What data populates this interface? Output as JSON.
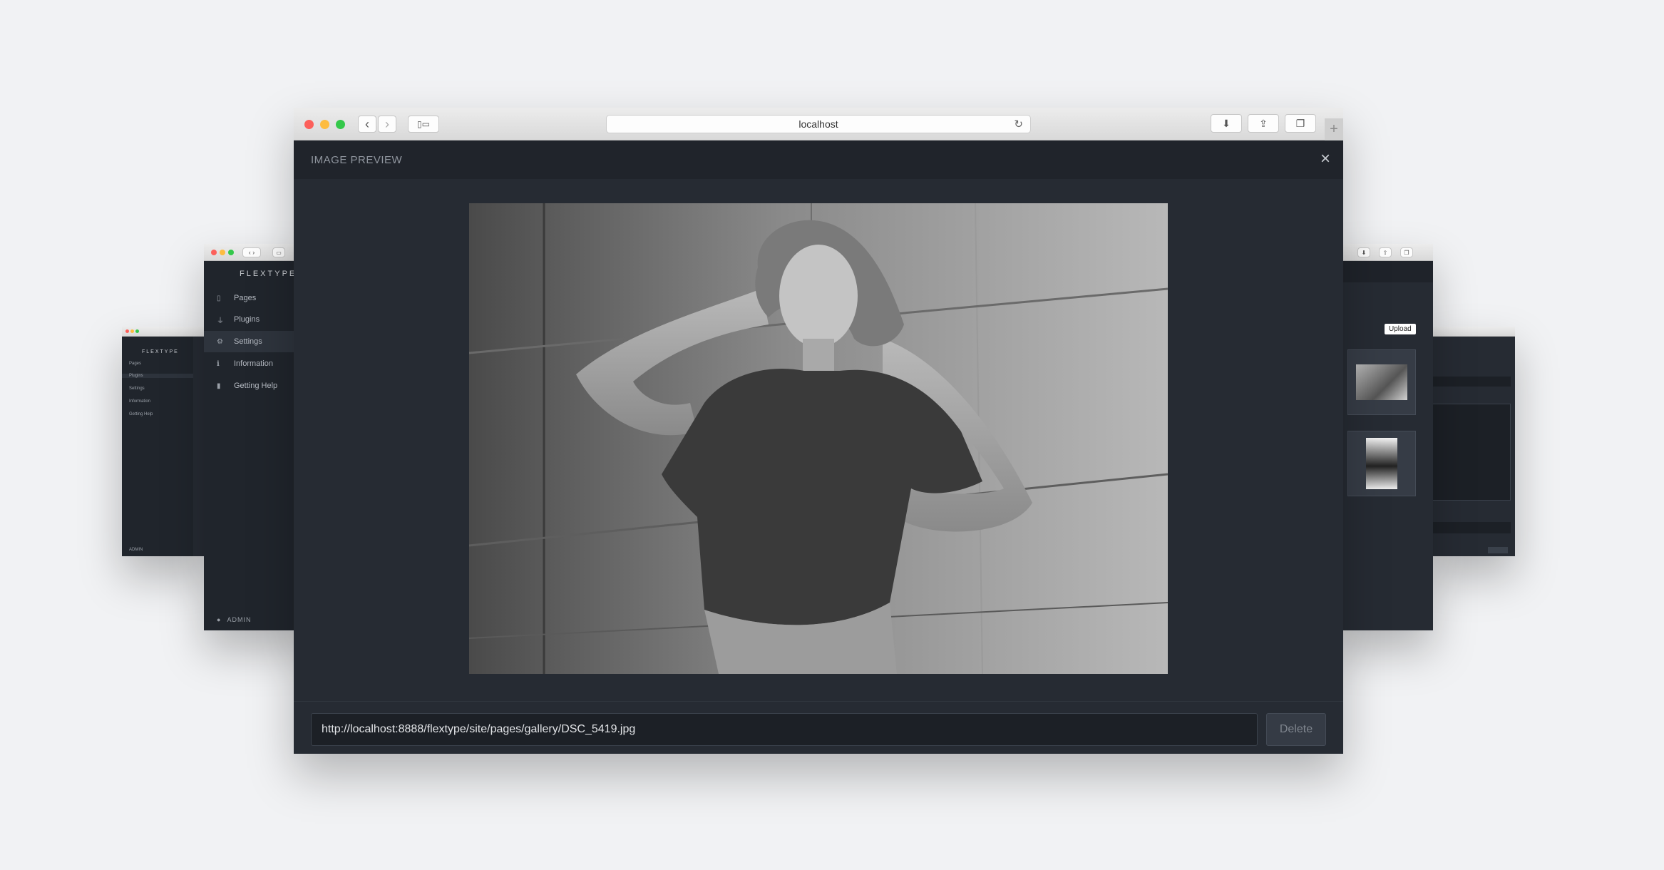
{
  "browser": {
    "url": "localhost"
  },
  "cms": {
    "brand": "FLEXTYPE",
    "nav": [
      {
        "label": "Pages",
        "icon": "page-icon"
      },
      {
        "label": "Plugins",
        "icon": "plug-icon"
      },
      {
        "label": "Settings",
        "icon": "gear-icon"
      },
      {
        "label": "Information",
        "icon": "info-icon"
      },
      {
        "label": "Getting Help",
        "icon": "book-icon"
      }
    ],
    "admin_label": "ADMIN",
    "admin_label_small": "ADMIN",
    "upload_label": "Upload"
  },
  "modal": {
    "title": "IMAGE PREVIEW",
    "image_url": "http://localhost:8888/flextype/site/pages/gallery/DSC_5419.jpg",
    "delete_label": "Delete",
    "close_icon": "close-icon"
  },
  "colors": {
    "page_bg": "#f1f2f4",
    "modal_bg": "#262b33",
    "sidebar_bg": "#20252c"
  }
}
